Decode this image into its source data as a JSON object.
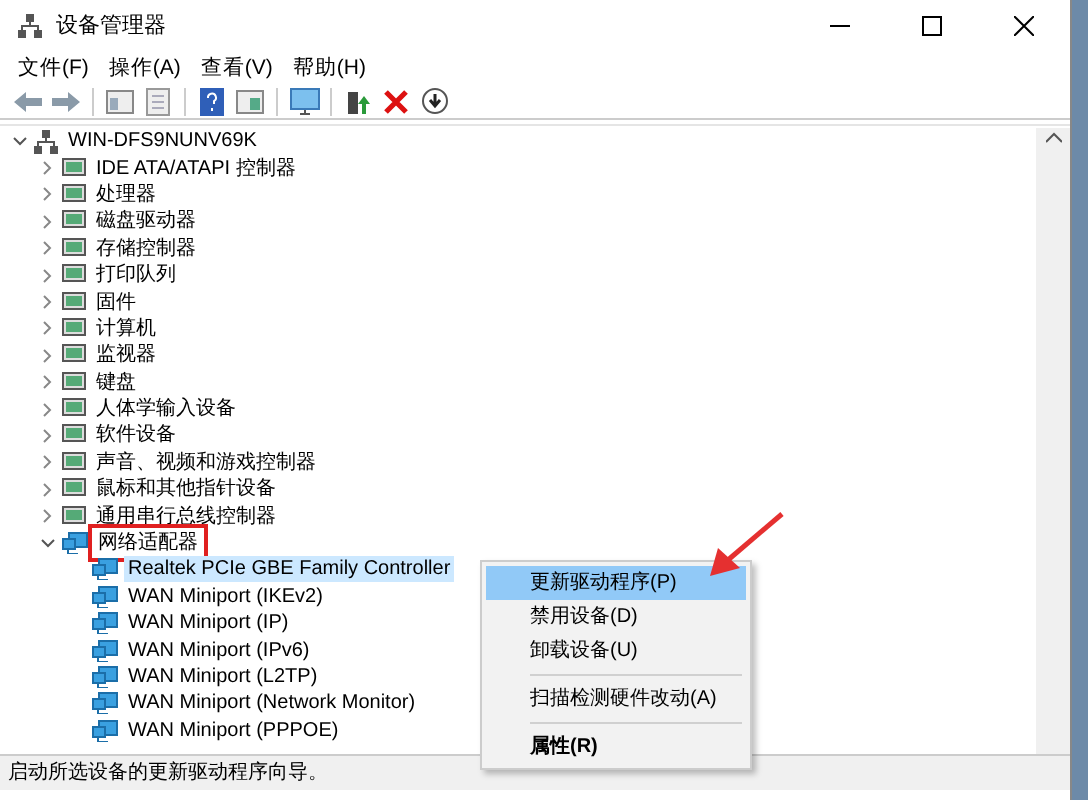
{
  "window": {
    "title": "设备管理器"
  },
  "menu": [
    "文件(F)",
    "操作(A)",
    "查看(V)",
    "帮助(H)"
  ],
  "tree": {
    "label": "WIN-DFS9NUNV69K",
    "expanded": true,
    "children": [
      {
        "label": "IDE ATA/ATAPI 控制器",
        "expanded": false,
        "selected": false,
        "highlighted": false
      },
      {
        "label": "处理器",
        "expanded": false,
        "selected": false,
        "highlighted": false
      },
      {
        "label": "磁盘驱动器",
        "expanded": false,
        "selected": false,
        "highlighted": false
      },
      {
        "label": "存储控制器",
        "expanded": false,
        "selected": false,
        "highlighted": false
      },
      {
        "label": "打印队列",
        "expanded": false,
        "selected": false,
        "highlighted": false
      },
      {
        "label": "固件",
        "expanded": false,
        "selected": false,
        "highlighted": false
      },
      {
        "label": "计算机",
        "expanded": false,
        "selected": false,
        "highlighted": false
      },
      {
        "label": "监视器",
        "expanded": false,
        "selected": false,
        "highlighted": false
      },
      {
        "label": "键盘",
        "expanded": false,
        "selected": false,
        "highlighted": false
      },
      {
        "label": "人体学输入设备",
        "expanded": false,
        "selected": false,
        "highlighted": false
      },
      {
        "label": "软件设备",
        "expanded": false,
        "selected": false,
        "highlighted": false
      },
      {
        "label": "声音、视频和游戏控制器",
        "expanded": false,
        "selected": false,
        "highlighted": false
      },
      {
        "label": "鼠标和其他指针设备",
        "expanded": false,
        "selected": false,
        "highlighted": false
      },
      {
        "label": "通用串行总线控制器",
        "expanded": false,
        "selected": false,
        "highlighted": false
      },
      {
        "label": "网络适配器",
        "expanded": true,
        "selected": false,
        "highlighted": true,
        "children": [
          {
            "label": "Realtek PCIe GBE Family Controller",
            "selected": true
          },
          {
            "label": "WAN Miniport (IKEv2)",
            "selected": false
          },
          {
            "label": "WAN Miniport (IP)",
            "selected": false
          },
          {
            "label": "WAN Miniport (IPv6)",
            "selected": false
          },
          {
            "label": "WAN Miniport (L2TP)",
            "selected": false
          },
          {
            "label": "WAN Miniport (Network Monitor)",
            "selected": false
          },
          {
            "label": "WAN Miniport (PPPOE)",
            "selected": false
          }
        ]
      }
    ]
  },
  "context_menu": [
    {
      "kind": "item",
      "label": "更新驱动程序(P)",
      "selected": true,
      "bold": false
    },
    {
      "kind": "item",
      "label": "禁用设备(D)",
      "selected": false,
      "bold": false
    },
    {
      "kind": "item",
      "label": "卸载设备(U)",
      "selected": false,
      "bold": false
    },
    {
      "kind": "separator"
    },
    {
      "kind": "item",
      "label": "扫描检测硬件改动(A)",
      "selected": false,
      "bold": false
    },
    {
      "kind": "separator"
    },
    {
      "kind": "item",
      "label": "属性(R)",
      "selected": false,
      "bold": true
    }
  ],
  "status_bar": "启动所选设备的更新驱动程序向导。"
}
